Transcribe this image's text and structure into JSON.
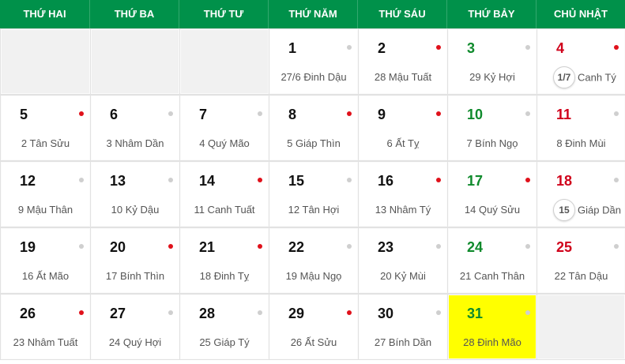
{
  "headers": [
    "THỨ HAI",
    "THỨ BA",
    "THỨ TƯ",
    "THỨ NĂM",
    "THỨ SÁU",
    "THỨ BẢY",
    "CHỦ NHẬT"
  ],
  "colors": {
    "header_bg": "#00914a",
    "saturday": "#0f8a2c",
    "sunday": "#d0021b",
    "dot_red": "#e0111b",
    "dot_gray": "#cfcfcf",
    "highlight": "#ffff00"
  },
  "weeks": [
    [
      null,
      null,
      null,
      {
        "day": "1",
        "lunar": "27/6 Đinh Dậu",
        "dot": "gray"
      },
      {
        "day": "2",
        "lunar": "28 Mậu Tuất",
        "dot": "red"
      },
      {
        "day": "3",
        "lunar": "29 Kỷ Hợi",
        "dot": "gray"
      },
      {
        "day": "4",
        "lunar": "Canh Tý",
        "badge": "1/7",
        "dot": "red"
      }
    ],
    [
      {
        "day": "5",
        "lunar": "2 Tân Sửu",
        "dot": "red"
      },
      {
        "day": "6",
        "lunar": "3 Nhâm Dần",
        "dot": "gray"
      },
      {
        "day": "7",
        "lunar": "4 Quý Mão",
        "dot": "gray"
      },
      {
        "day": "8",
        "lunar": "5 Giáp Thìn",
        "dot": "red"
      },
      {
        "day": "9",
        "lunar": "6 Ất Tỵ",
        "dot": "red"
      },
      {
        "day": "10",
        "lunar": "7 Bính Ngọ",
        "dot": "gray"
      },
      {
        "day": "11",
        "lunar": "8 Đinh Mùi",
        "dot": "gray"
      }
    ],
    [
      {
        "day": "12",
        "lunar": "9 Mậu Thân",
        "dot": "gray"
      },
      {
        "day": "13",
        "lunar": "10 Kỷ Dậu",
        "dot": "gray"
      },
      {
        "day": "14",
        "lunar": "11 Canh Tuất",
        "dot": "red"
      },
      {
        "day": "15",
        "lunar": "12 Tân Hợi",
        "dot": "gray"
      },
      {
        "day": "16",
        "lunar": "13 Nhâm Tý",
        "dot": "red"
      },
      {
        "day": "17",
        "lunar": "14 Quý Sửu",
        "dot": "red"
      },
      {
        "day": "18",
        "lunar": "Giáp Dần",
        "badge": "15",
        "dot": "gray"
      }
    ],
    [
      {
        "day": "19",
        "lunar": "16 Ất Mão",
        "dot": "gray"
      },
      {
        "day": "20",
        "lunar": "17 Bính Thìn",
        "dot": "red"
      },
      {
        "day": "21",
        "lunar": "18 Đinh Tỵ",
        "dot": "red"
      },
      {
        "day": "22",
        "lunar": "19 Mậu Ngọ",
        "dot": "gray"
      },
      {
        "day": "23",
        "lunar": "20 Kỷ Mùi",
        "dot": "gray"
      },
      {
        "day": "24",
        "lunar": "21 Canh Thân",
        "dot": "gray"
      },
      {
        "day": "25",
        "lunar": "22 Tân Dậu",
        "dot": "gray"
      }
    ],
    [
      {
        "day": "26",
        "lunar": "23 Nhâm Tuất",
        "dot": "red"
      },
      {
        "day": "27",
        "lunar": "24 Quý Hợi",
        "dot": "gray"
      },
      {
        "day": "28",
        "lunar": "25 Giáp Tý",
        "dot": "gray"
      },
      {
        "day": "29",
        "lunar": "26 Ất Sửu",
        "dot": "red"
      },
      {
        "day": "30",
        "lunar": "27 Bính Dần",
        "dot": "gray"
      },
      {
        "day": "31",
        "lunar": "28 Đinh Mão",
        "dot": "gray",
        "highlight": true
      },
      null
    ]
  ]
}
